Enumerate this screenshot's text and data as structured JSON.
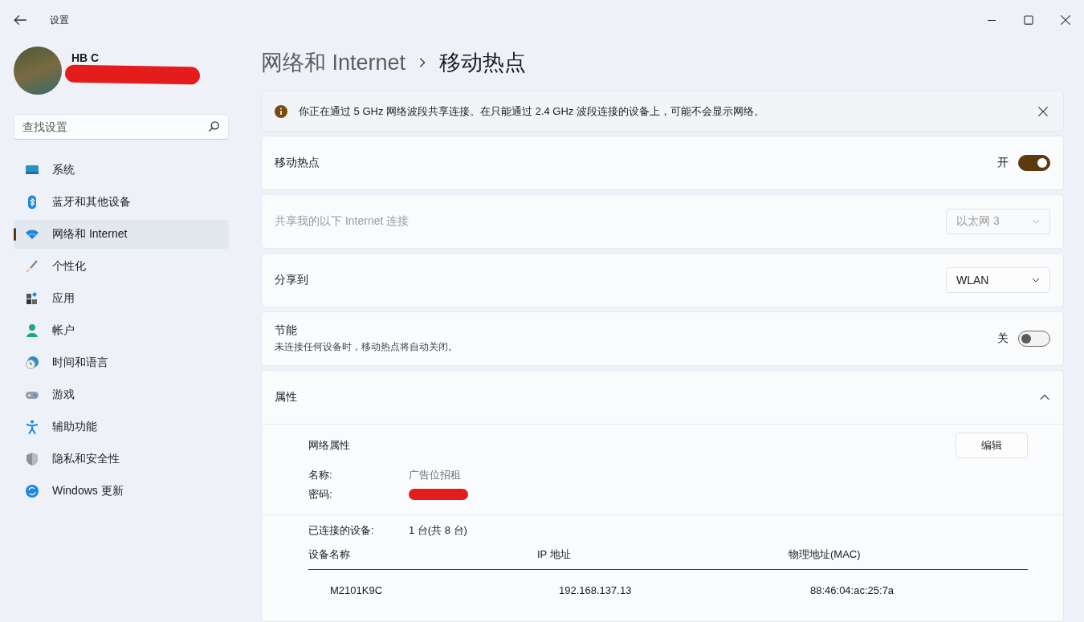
{
  "window": {
    "title": "设置"
  },
  "user": {
    "name": "HB C"
  },
  "search": {
    "placeholder": "查找设置"
  },
  "sidebar": {
    "items": [
      {
        "label": "系统",
        "selected": false
      },
      {
        "label": "蓝牙和其他设备",
        "selected": false
      },
      {
        "label": "网络和 Internet",
        "selected": true
      },
      {
        "label": "个性化",
        "selected": false
      },
      {
        "label": "应用",
        "selected": false
      },
      {
        "label": "帐户",
        "selected": false
      },
      {
        "label": "时间和语言",
        "selected": false
      },
      {
        "label": "游戏",
        "selected": false
      },
      {
        "label": "辅助功能",
        "selected": false
      },
      {
        "label": "隐私和安全性",
        "selected": false
      },
      {
        "label": "Windows 更新",
        "selected": false
      }
    ]
  },
  "breadcrumb": [
    "网络和 Internet",
    "移动热点"
  ],
  "banner": {
    "text": "你正在通过 5 GHz 网络波段共享连接。在只能通过 2.4 GHz 波段连接的设备上，可能不会显示网络。"
  },
  "settings": [
    {
      "kind": "toggle",
      "label": "移动热点",
      "state_label": "开",
      "on": true
    },
    {
      "kind": "dropdown",
      "label": "共享我的以下 Internet 连接",
      "value": "以太网 3",
      "disabled": true
    },
    {
      "kind": "dropdown",
      "label": "分享到",
      "value": "WLAN",
      "disabled": false
    },
    {
      "kind": "toggle",
      "label": "节能",
      "description": "未连接任何设备时，移动热点将自动关闭。",
      "state_label": "关",
      "on": false
    }
  ],
  "properties": {
    "title": "属性",
    "expanded": true,
    "section_title": "网络属性",
    "edit_button": "编辑",
    "fields": [
      {
        "label": "名称:",
        "value": "广告位招租"
      },
      {
        "label": "密码:",
        "redacted": true
      }
    ],
    "connected": {
      "label": "已连接的设备:",
      "value": "1 台(共 8 台)"
    },
    "table": {
      "columns": [
        "设备名称",
        "IP 地址",
        "物理地址(MAC)"
      ],
      "rows": [
        [
          "M2101K9C",
          "192.168.137.13",
          "88:46:04:ac:25:7a"
        ]
      ]
    }
  }
}
